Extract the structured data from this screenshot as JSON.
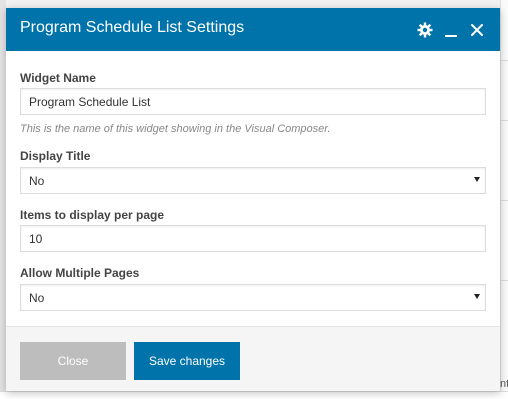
{
  "modal": {
    "title": "Program Schedule List Settings",
    "header_color": "#0073aa",
    "icons": [
      "gear-icon",
      "minimize-icon",
      "close-icon"
    ]
  },
  "fields": {
    "widget_name": {
      "label": "Widget Name",
      "value": "Program Schedule List",
      "help": "This is the name of this widget showing in the Visual Composer."
    },
    "display_title": {
      "label": "Display Title",
      "selected": "No"
    },
    "items_per_page": {
      "label": "Items to display per page",
      "value": "10"
    },
    "allow_multiple_pages": {
      "label": "Allow Multiple Pages",
      "selected": "No"
    }
  },
  "footer": {
    "close_label": "Close",
    "save_label": "Save changes"
  },
  "background": {
    "edge_text": "nt"
  }
}
